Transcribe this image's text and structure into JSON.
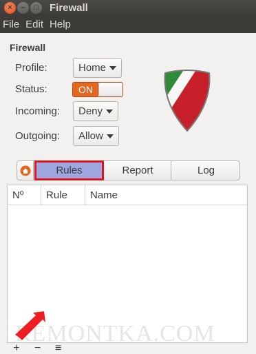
{
  "window": {
    "title": "Firewall"
  },
  "menu": {
    "items": [
      "File",
      "Edit",
      "Help"
    ]
  },
  "panel": {
    "section_title": "Firewall",
    "profile": {
      "label": "Profile:",
      "value": "Home"
    },
    "status": {
      "label": "Status:",
      "value": "ON"
    },
    "incoming": {
      "label": "Incoming:",
      "value": "Deny"
    },
    "outgoing": {
      "label": "Outgoing:",
      "value": "Allow"
    }
  },
  "tabs": {
    "home_icon": "home-icon",
    "rules": "Rules",
    "report": "Report",
    "log": "Log"
  },
  "table": {
    "columns": [
      "Nº",
      "Rule",
      "Name"
    ],
    "rows": []
  },
  "toolbar": {
    "add": "+",
    "remove": "−",
    "options": "≡"
  },
  "watermark": "REMONTKA.COM",
  "colors": {
    "accent": "#e5661f",
    "selected_tab": "#9ea7e0",
    "highlight": "#e1141e"
  }
}
